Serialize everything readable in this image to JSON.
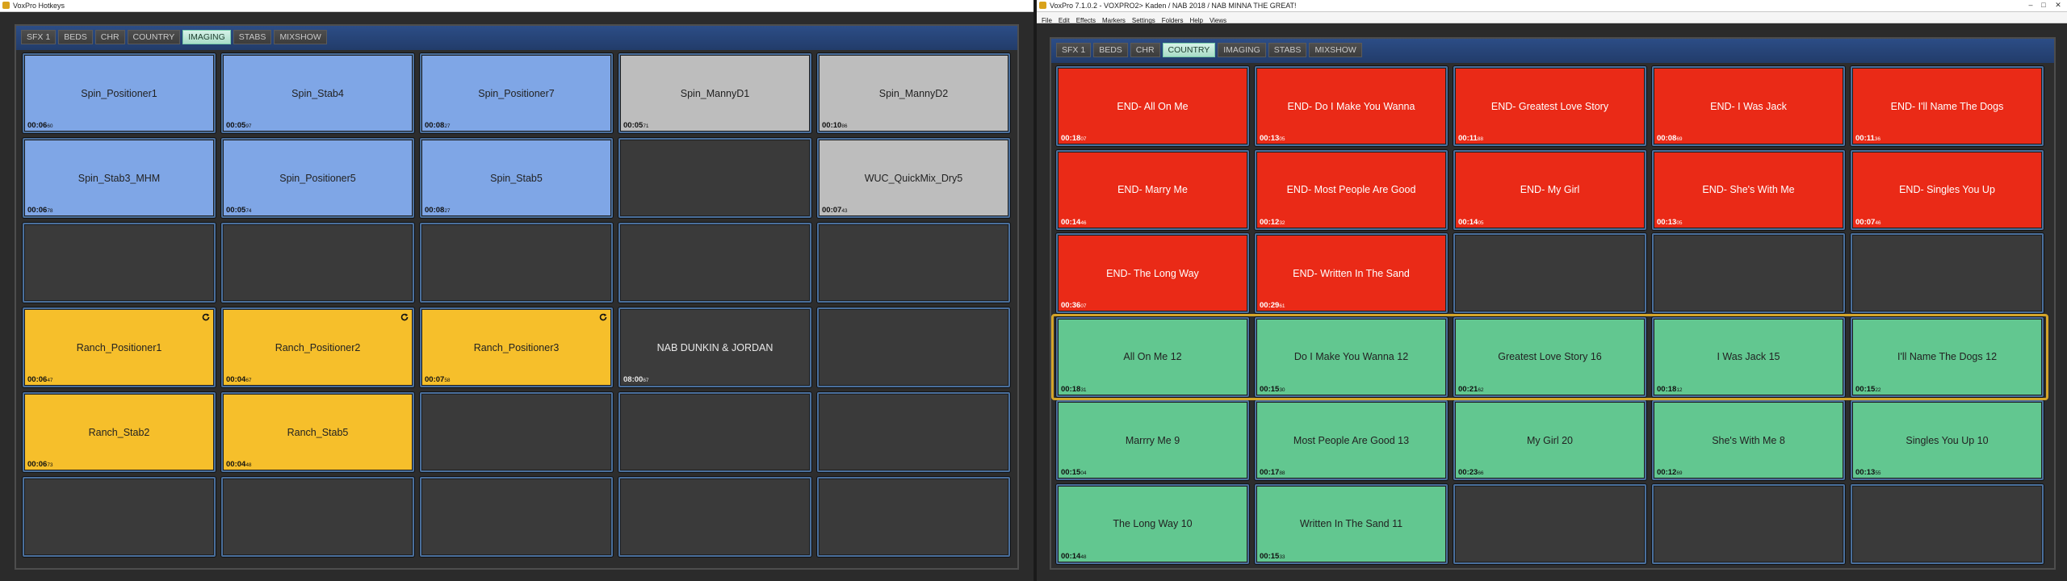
{
  "left": {
    "title": "VoxPro Hotkeys",
    "tabs": [
      "SFX 1",
      "BEDS",
      "CHR",
      "COUNTRY",
      "IMAGING",
      "STABS",
      "MIXSHOW"
    ],
    "active_tab": "IMAGING",
    "rows": [
      [
        {
          "label": "Spin_Positioner1",
          "t": "00:06",
          "ms": "60",
          "color": "blue"
        },
        {
          "label": "Spin_Stab4",
          "t": "00:05",
          "ms": "97",
          "color": "blue"
        },
        {
          "label": "Spin_Positioner7",
          "t": "00:08",
          "ms": "27",
          "color": "blue"
        },
        {
          "label": "Spin_MannyD1",
          "t": "00:05",
          "ms": "71",
          "color": "gray"
        },
        {
          "label": "Spin_MannyD2",
          "t": "00:10",
          "ms": "86",
          "color": "gray"
        }
      ],
      [
        {
          "label": "Spin_Stab3_MHM",
          "t": "00:06",
          "ms": "78",
          "color": "blue"
        },
        {
          "label": "Spin_Positioner5",
          "t": "00:05",
          "ms": "74",
          "color": "blue"
        },
        {
          "label": "Spin_Stab5",
          "t": "00:08",
          "ms": "27",
          "color": "blue"
        },
        {
          "color": "empty"
        },
        {
          "label": "WUC_QuickMix_Dry5",
          "t": "00:07",
          "ms": "43",
          "color": "gray"
        }
      ],
      [
        {
          "color": "empty"
        },
        {
          "color": "empty"
        },
        {
          "color": "empty"
        },
        {
          "color": "empty"
        },
        {
          "color": "empty"
        }
      ],
      [
        {
          "label": "Ranch_Positioner1",
          "t": "00:06",
          "ms": "47",
          "color": "yellow",
          "loop": true
        },
        {
          "label": "Ranch_Positioner2",
          "t": "00:04",
          "ms": "67",
          "color": "yellow",
          "loop": true
        },
        {
          "label": "Ranch_Positioner3",
          "t": "00:07",
          "ms": "58",
          "color": "yellow",
          "loop": true
        },
        {
          "label": "NAB DUNKIN & JORDAN",
          "t": "08:00",
          "ms": "67",
          "color": "dark"
        },
        {
          "color": "empty"
        }
      ],
      [
        {
          "label": "Ranch_Stab2",
          "t": "00:06",
          "ms": "73",
          "color": "yellow"
        },
        {
          "label": "Ranch_Stab5",
          "t": "00:04",
          "ms": "48",
          "color": "yellow"
        },
        {
          "color": "empty"
        },
        {
          "color": "empty"
        },
        {
          "color": "empty"
        }
      ],
      [
        {
          "color": "empty"
        },
        {
          "color": "empty"
        },
        {
          "color": "empty"
        },
        {
          "color": "empty"
        },
        {
          "color": "empty"
        }
      ]
    ]
  },
  "right": {
    "title": "VoxPro 7.1.0.2 - VOXPRO2> Kaden / NAB 2018 / NAB MINNA THE GREAT!",
    "menu": [
      "File",
      "Edit",
      "Effects",
      "Markers",
      "Settings",
      "Folders",
      "Help",
      "Views"
    ],
    "tabs": [
      "SFX 1",
      "BEDS",
      "CHR",
      "COUNTRY",
      "IMAGING",
      "STABS",
      "MIXSHOW"
    ],
    "active_tab": "COUNTRY",
    "rows": [
      [
        {
          "label": "END- All On Me",
          "t": "00:18",
          "ms": "07",
          "color": "red"
        },
        {
          "label": "END- Do I Make You Wanna",
          "t": "00:13",
          "ms": "05",
          "color": "red"
        },
        {
          "label": "END- Greatest Love Story",
          "t": "00:11",
          "ms": "88",
          "color": "red"
        },
        {
          "label": "END- I Was Jack",
          "t": "00:08",
          "ms": "69",
          "color": "red"
        },
        {
          "label": "END- I'll Name The Dogs",
          "t": "00:11",
          "ms": "36",
          "color": "red"
        }
      ],
      [
        {
          "label": "END- Marry Me",
          "t": "00:14",
          "ms": "46",
          "color": "red"
        },
        {
          "label": "END- Most People Are Good",
          "t": "00:12",
          "ms": "32",
          "color": "red"
        },
        {
          "label": "END- My Girl",
          "t": "00:14",
          "ms": "05",
          "color": "red"
        },
        {
          "label": "END- She's With Me",
          "t": "00:13",
          "ms": "05",
          "color": "red"
        },
        {
          "label": "END- Singles You Up",
          "t": "00:07",
          "ms": "46",
          "color": "red"
        }
      ],
      [
        {
          "label": "END- The Long Way",
          "t": "00:36",
          "ms": "07",
          "color": "red"
        },
        {
          "label": "END- Written In The Sand",
          "t": "00:29",
          "ms": "61",
          "color": "red"
        },
        {
          "color": "empty"
        },
        {
          "color": "empty"
        },
        {
          "color": "empty"
        }
      ],
      [
        {
          "label": "All On Me 12",
          "t": "00:18",
          "ms": "31",
          "color": "green"
        },
        {
          "label": "Do I Make You Wanna 12",
          "t": "00:15",
          "ms": "30",
          "color": "green"
        },
        {
          "label": "Greatest Love Story 16",
          "t": "00:21",
          "ms": "62",
          "color": "green"
        },
        {
          "label": "I Was Jack 15",
          "t": "00:18",
          "ms": "12",
          "color": "green"
        },
        {
          "label": "I'll Name The Dogs 12",
          "t": "00:15",
          "ms": "22",
          "color": "green"
        }
      ],
      [
        {
          "label": "Marrry Me 9",
          "t": "00:15",
          "ms": "04",
          "color": "green"
        },
        {
          "label": "Most People Are Good 13",
          "t": "00:17",
          "ms": "88",
          "color": "green"
        },
        {
          "label": "My Girl 20",
          "t": "00:23",
          "ms": "66",
          "color": "green"
        },
        {
          "label": "She's With Me 8",
          "t": "00:12",
          "ms": "69",
          "color": "green"
        },
        {
          "label": "Singles You Up 10",
          "t": "00:13",
          "ms": "55",
          "color": "green"
        }
      ],
      [
        {
          "label": "The Long Way 10",
          "t": "00:14",
          "ms": "48",
          "color": "green"
        },
        {
          "label": "Written In The Sand 11",
          "t": "00:15",
          "ms": "33",
          "color": "green"
        },
        {
          "color": "empty"
        },
        {
          "color": "empty"
        },
        {
          "color": "empty"
        }
      ]
    ],
    "highlighted_row": 3
  },
  "window_controls": [
    "–",
    "□",
    "✕"
  ],
  "icons": {
    "loop": "loop-icon",
    "app": "app-icon"
  }
}
